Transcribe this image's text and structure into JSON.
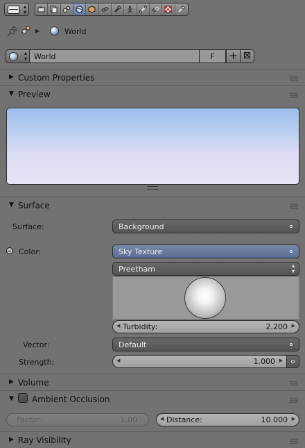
{
  "context": {
    "world_label": "World"
  },
  "datablock": {
    "name": "World",
    "fake_user": "F"
  },
  "panels": {
    "custom_properties": "Custom Properties",
    "preview": "Preview",
    "surface": "Surface",
    "volume": "Volume",
    "ambient_occlusion": "Ambient Occlusion",
    "ray_visibility": "Ray Visibility"
  },
  "surface": {
    "surface_label": "Surface:",
    "surface_value": "Background",
    "color_label": "Color:",
    "color_value": "Sky Texture",
    "sky_type": "Preetham",
    "turbidity_label": "Turbidity:",
    "turbidity_value": "2.200",
    "vector_label": "Vector:",
    "vector_value": "Default",
    "strength_label": "Strength:",
    "strength_value": "1.000"
  },
  "ambient_occlusion": {
    "enabled": false,
    "factor_label": "Factor:",
    "factor_value": "1.00",
    "distance_label": "Distance:",
    "distance_value": "10.000"
  },
  "colors": {
    "active_tab": "#5c7aa6",
    "linked_field": "#6a7ea2",
    "panel_bg": "#727272"
  }
}
